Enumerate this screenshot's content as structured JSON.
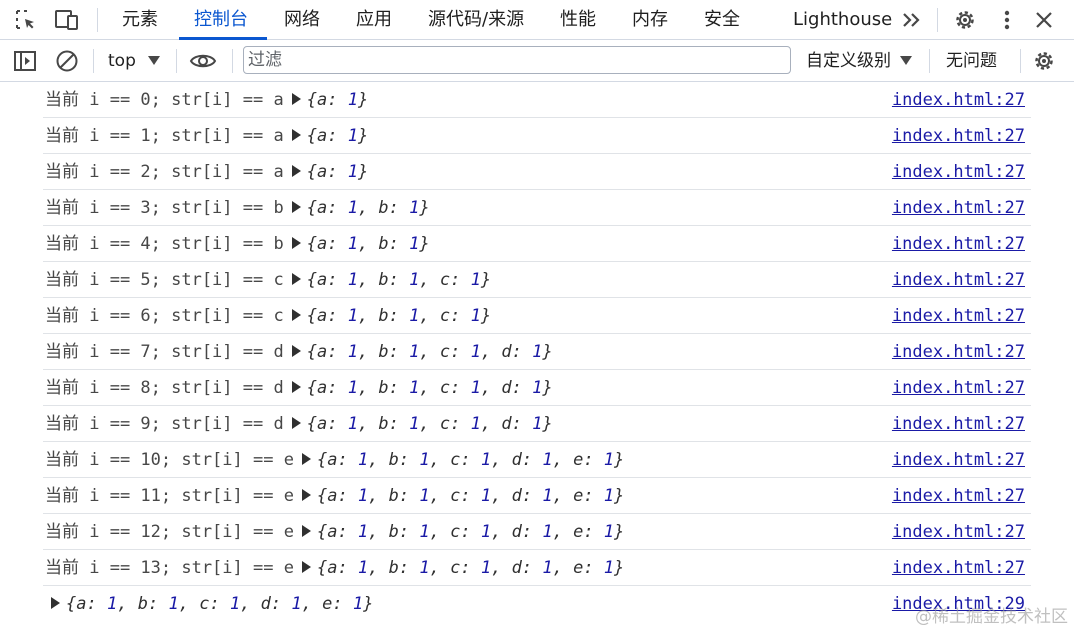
{
  "tabs": [
    {
      "label": "元素",
      "active": false
    },
    {
      "label": "控制台",
      "active": true
    },
    {
      "label": "网络",
      "active": false
    },
    {
      "label": "应用",
      "active": false
    },
    {
      "label": "源代码/来源",
      "active": false
    },
    {
      "label": "性能",
      "active": false
    },
    {
      "label": "内存",
      "active": false
    },
    {
      "label": "安全",
      "active": false
    },
    {
      "label": "Lighthouse",
      "active": false
    }
  ],
  "toolbar": {
    "context": "top",
    "filter_placeholder": "过滤",
    "levels": "自定义级别",
    "issues": "无问题"
  },
  "logs": [
    {
      "text": "当前 i == 0; str[i] == a",
      "obj": [
        [
          "a",
          "1"
        ]
      ],
      "source": "index.html:27"
    },
    {
      "text": "当前 i == 1; str[i] == a",
      "obj": [
        [
          "a",
          "1"
        ]
      ],
      "source": "index.html:27"
    },
    {
      "text": "当前 i == 2; str[i] == a",
      "obj": [
        [
          "a",
          "1"
        ]
      ],
      "source": "index.html:27"
    },
    {
      "text": "当前 i == 3; str[i] == b",
      "obj": [
        [
          "a",
          "1"
        ],
        [
          "b",
          "1"
        ]
      ],
      "source": "index.html:27"
    },
    {
      "text": "当前 i == 4; str[i] == b",
      "obj": [
        [
          "a",
          "1"
        ],
        [
          "b",
          "1"
        ]
      ],
      "source": "index.html:27"
    },
    {
      "text": "当前 i == 5; str[i] == c",
      "obj": [
        [
          "a",
          "1"
        ],
        [
          "b",
          "1"
        ],
        [
          "c",
          "1"
        ]
      ],
      "source": "index.html:27"
    },
    {
      "text": "当前 i == 6; str[i] == c",
      "obj": [
        [
          "a",
          "1"
        ],
        [
          "b",
          "1"
        ],
        [
          "c",
          "1"
        ]
      ],
      "source": "index.html:27"
    },
    {
      "text": "当前 i == 7; str[i] == d",
      "obj": [
        [
          "a",
          "1"
        ],
        [
          "b",
          "1"
        ],
        [
          "c",
          "1"
        ],
        [
          "d",
          "1"
        ]
      ],
      "source": "index.html:27"
    },
    {
      "text": "当前 i == 8; str[i] == d",
      "obj": [
        [
          "a",
          "1"
        ],
        [
          "b",
          "1"
        ],
        [
          "c",
          "1"
        ],
        [
          "d",
          "1"
        ]
      ],
      "source": "index.html:27"
    },
    {
      "text": "当前 i == 9; str[i] == d",
      "obj": [
        [
          "a",
          "1"
        ],
        [
          "b",
          "1"
        ],
        [
          "c",
          "1"
        ],
        [
          "d",
          "1"
        ]
      ],
      "source": "index.html:27"
    },
    {
      "text": "当前 i == 10; str[i] == e",
      "obj": [
        [
          "a",
          "1"
        ],
        [
          "b",
          "1"
        ],
        [
          "c",
          "1"
        ],
        [
          "d",
          "1"
        ],
        [
          "e",
          "1"
        ]
      ],
      "source": "index.html:27"
    },
    {
      "text": "当前 i == 11; str[i] == e",
      "obj": [
        [
          "a",
          "1"
        ],
        [
          "b",
          "1"
        ],
        [
          "c",
          "1"
        ],
        [
          "d",
          "1"
        ],
        [
          "e",
          "1"
        ]
      ],
      "source": "index.html:27"
    },
    {
      "text": "当前 i == 12; str[i] == e",
      "obj": [
        [
          "a",
          "1"
        ],
        [
          "b",
          "1"
        ],
        [
          "c",
          "1"
        ],
        [
          "d",
          "1"
        ],
        [
          "e",
          "1"
        ]
      ],
      "source": "index.html:27"
    },
    {
      "text": "当前 i == 13; str[i] == e",
      "obj": [
        [
          "a",
          "1"
        ],
        [
          "b",
          "1"
        ],
        [
          "c",
          "1"
        ],
        [
          "d",
          "1"
        ],
        [
          "e",
          "1"
        ]
      ],
      "source": "index.html:27"
    },
    {
      "text": "",
      "obj": [
        [
          "a",
          "1"
        ],
        [
          "b",
          "1"
        ],
        [
          "c",
          "1"
        ],
        [
          "d",
          "1"
        ],
        [
          "e",
          "1"
        ]
      ],
      "source": "index.html:29"
    }
  ],
  "watermark": "@稀土掘金技术社区",
  "colors": {
    "accent": "#0b57d0",
    "link": "#1a1aa6",
    "number": "#1a1aa6"
  }
}
